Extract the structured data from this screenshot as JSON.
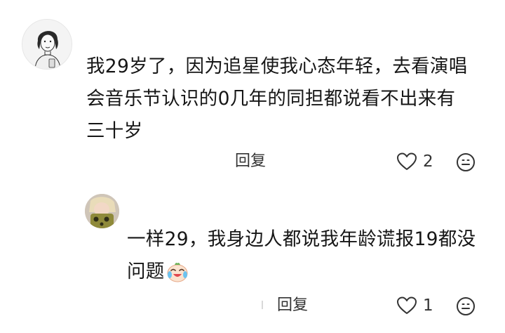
{
  "comment": {
    "avatar_icon": "user-avatar-sketch-icon",
    "text_lines": [
      "我29岁了，因为追星使我心态年轻，去看演唱",
      "会音乐节认识的0几年的同担都说看不出来有",
      "三十岁"
    ],
    "reply_label": "回复",
    "like_count": "2",
    "like_icon": "heart-outline-icon",
    "react_icon": "smiley-face-icon"
  },
  "reply": {
    "avatar_icon": "user-avatar-photo-icon",
    "text_lines": [
      "一样29，我身边人都说我年龄谎报19都没",
      "问题"
    ],
    "emoji": "laugh-cry-emoji-icon",
    "reply_label": "回复",
    "like_count": "1",
    "like_icon": "heart-outline-icon",
    "react_icon": "smiley-face-icon"
  }
}
